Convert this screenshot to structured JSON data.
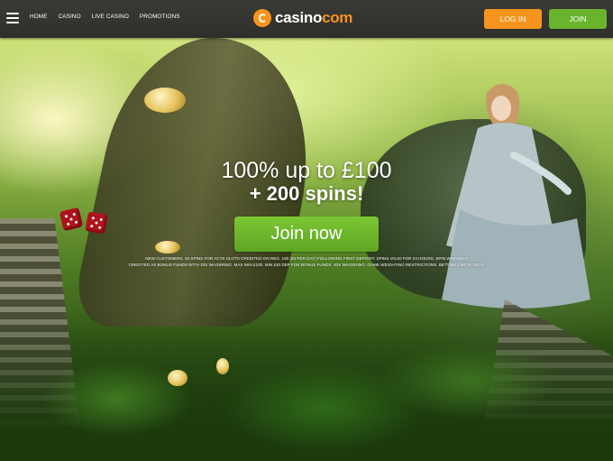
{
  "header": {
    "nav": [
      "HOME",
      "CASINO",
      "LIVE CASINO",
      "PROMOTIONS"
    ],
    "logo": {
      "part1": "casino",
      "part2": "com"
    },
    "login_label": "LOG IN",
    "join_label": "JOIN"
  },
  "hero": {
    "headline": "100% up to £100",
    "subline": "+ 200 spins!",
    "cta_label": "Join now",
    "terms_line1": "NEW CUSTOMERS. 20 SPINS FOR ACTS SLOTS CREDITED ON REG. 180 (20 PER DAY) FOLLOWING FIRST DEPOSIT. SPINS VALID FOR 24 HOURS. SPIN WINNINGS",
    "terms_line2": "CREDITED AS BONUS FUNDS WITH 20X WAGERING. MAX WIN £100. MIN £20 DEP FOR BONUS FUNDS. 40X WAGERING. GAME WEIGHTING RESTRICTIONS. BETTING LIMITS T&CS."
  },
  "colors": {
    "brand_orange": "#f7941d",
    "join_green": "#6ab42d",
    "header_bg": "#33332f"
  }
}
